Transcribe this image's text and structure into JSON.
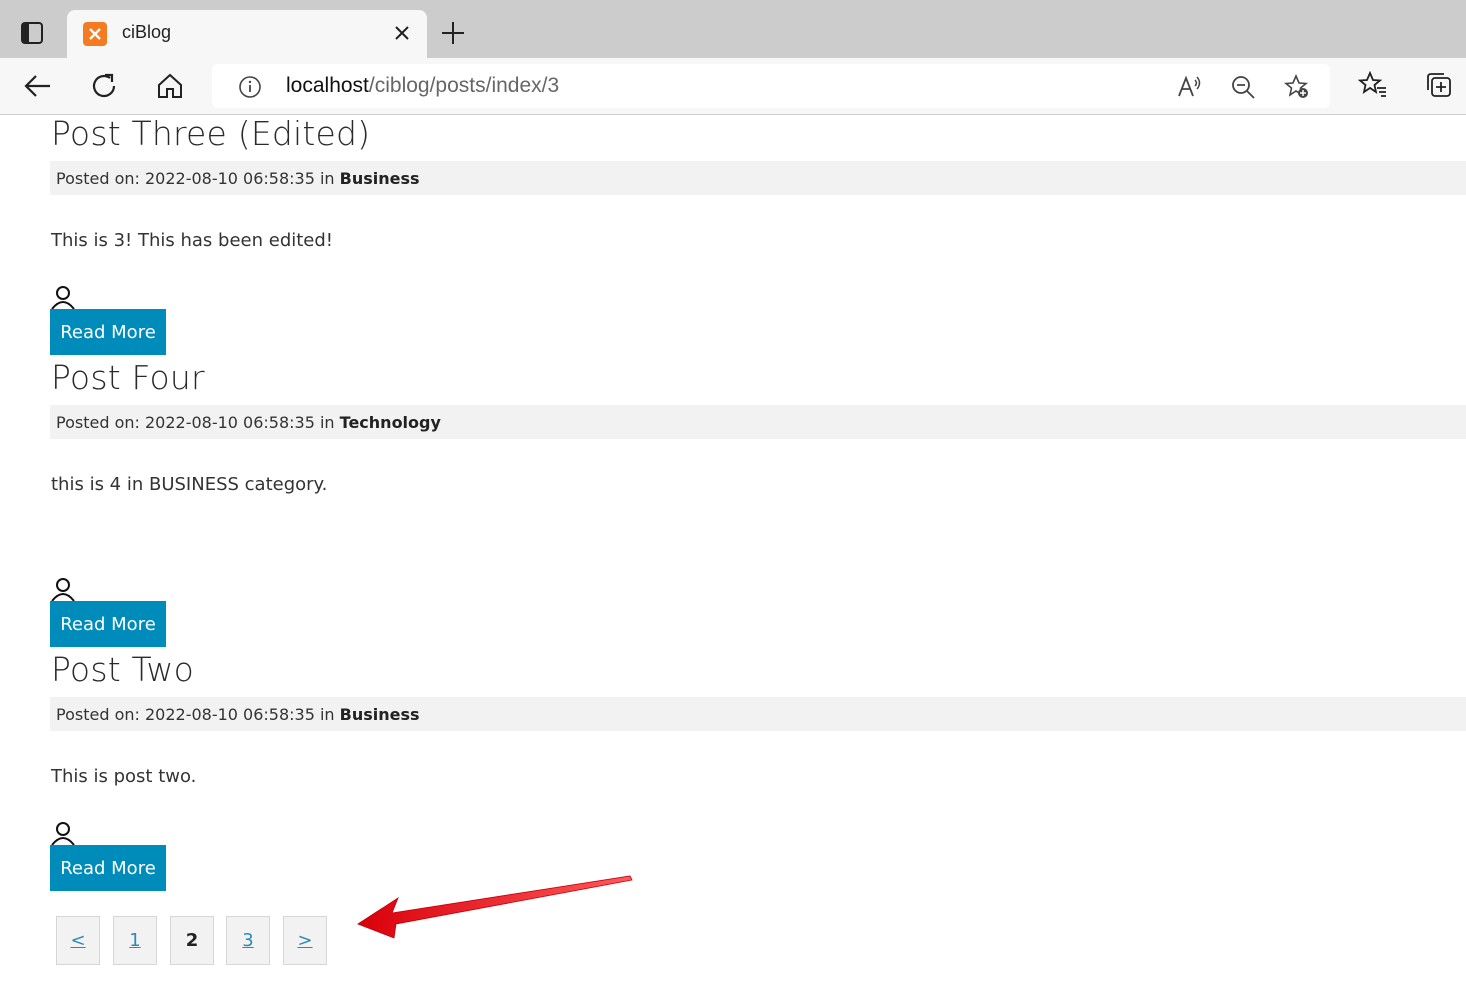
{
  "browser": {
    "tab_title": "ciBlog",
    "url_host": "localhost",
    "url_path": "/ciblog/posts/index/3"
  },
  "posts": [
    {
      "title": "Post Three (Edited)",
      "meta_prefix": "Posted on: 2022-08-10 06:58:35 in ",
      "category": "Business",
      "body": "This is 3! This has been edited!",
      "read_more": "Read More"
    },
    {
      "title": "Post Four",
      "meta_prefix": "Posted on: 2022-08-10 06:58:35 in ",
      "category": "Technology",
      "body": "this is 4 in BUSINESS category.",
      "read_more": "Read More"
    },
    {
      "title": "Post Two",
      "meta_prefix": "Posted on: 2022-08-10 06:58:35 in ",
      "category": "Business",
      "body": "This is post two.",
      "read_more": "Read More"
    }
  ],
  "pagination": {
    "prev": "<",
    "pages": [
      "1",
      "2",
      "3"
    ],
    "current": "2",
    "next": ">"
  },
  "colors": {
    "read_more_bg": "#008cba",
    "annotation_arrow": "#e8141c"
  }
}
